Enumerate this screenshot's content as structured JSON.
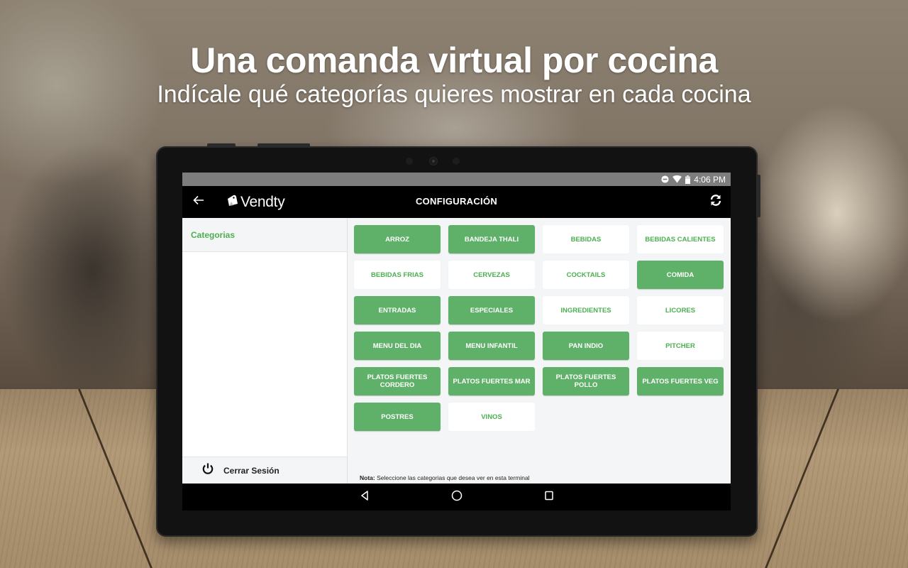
{
  "promo": {
    "headline": "Una comanda virtual por cocina",
    "subheadline": "Indícale qué categorías quieres mostrar en cada cocina"
  },
  "status_bar": {
    "icons": [
      "do-not-disturb-icon",
      "wifi-icon",
      "battery-icon"
    ],
    "time": "4:06 PM"
  },
  "app_bar": {
    "back_icon": "arrow-left-icon",
    "logo_text": "Vendty",
    "title": "CONFIGURACIÓN",
    "refresh_icon": "refresh-icon"
  },
  "sidebar": {
    "header": "Categorias",
    "footer": {
      "icon": "power-icon",
      "label": "Cerrar Sesión"
    }
  },
  "categories": [
    {
      "label": "ARROZ",
      "selected": true
    },
    {
      "label": "BANDEJA THALI",
      "selected": true
    },
    {
      "label": "BEBIDAS",
      "selected": false
    },
    {
      "label": "BEBIDAS CALIENTES",
      "selected": false
    },
    {
      "label": "BEBIDAS FRIAS",
      "selected": false
    },
    {
      "label": "CERVEZAS",
      "selected": false
    },
    {
      "label": "COCKTAILS",
      "selected": false
    },
    {
      "label": "COMIDA",
      "selected": true
    },
    {
      "label": "ENTRADAS",
      "selected": true
    },
    {
      "label": "ESPECIALES",
      "selected": true
    },
    {
      "label": "INGREDIENTES",
      "selected": false
    },
    {
      "label": "LICORES",
      "selected": false
    },
    {
      "label": "MENU DEL DIA",
      "selected": true
    },
    {
      "label": "MENU INFANTIL",
      "selected": true
    },
    {
      "label": "PAN INDIO",
      "selected": true
    },
    {
      "label": "PITCHER",
      "selected": false
    },
    {
      "label": "PLATOS FUERTES CORDERO",
      "selected": true
    },
    {
      "label": "PLATOS FUERTES MAR",
      "selected": true
    },
    {
      "label": "PLATOS FUERTES POLLO",
      "selected": true
    },
    {
      "label": "PLATOS FUERTES VEG",
      "selected": true
    },
    {
      "label": "POSTRES",
      "selected": true
    },
    {
      "label": "VINOS",
      "selected": false
    }
  ],
  "note": {
    "prefix": "Nota:",
    "text": " Seleccione las categorias que desea ver en esta terminal"
  },
  "nav_bar": {
    "buttons": [
      "back-triangle-icon",
      "home-circle-icon",
      "recents-square-icon"
    ]
  },
  "colors": {
    "accent_green": "#5fb068",
    "label_green": "#4caf50",
    "app_bar": "#000000",
    "status_bar": "#7d7d7d",
    "content_bg": "#f4f5f6"
  }
}
